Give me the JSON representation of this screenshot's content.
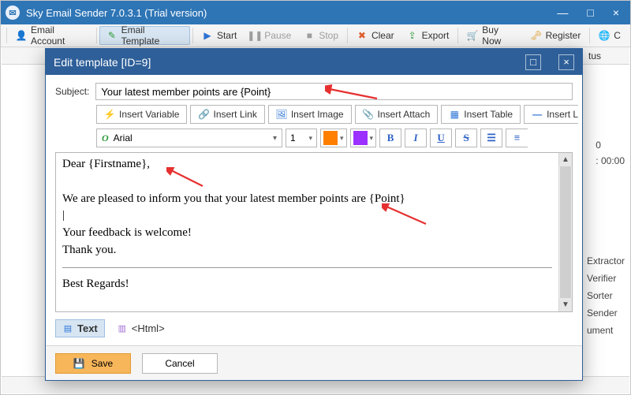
{
  "window": {
    "title": "Sky Email Sender 7.0.3.1 (Trial version)"
  },
  "toolbar": {
    "email_account": "Email Account",
    "email_template": "Email Template",
    "start": "Start",
    "pause": "Pause",
    "stop": "Stop",
    "clear": "Clear",
    "export": "Export",
    "buy_now": "Buy Now",
    "register": "Register",
    "check_update_trunc": "C"
  },
  "bg": {
    "col_status_trunc": "tus",
    "info_zero": "0",
    "info_time": ": 00:00",
    "side": {
      "extractor": "Extractor",
      "verifier": "Verifier",
      "sorter": "Sorter",
      "sender": "Sender",
      "ument": "ument"
    }
  },
  "dialog": {
    "title": "Edit template [ID=9]",
    "subject_label": "Subject:",
    "subject_value": "Your latest member points are {Point}",
    "insert_variable": "Insert Variable",
    "insert_link": "Insert Link",
    "insert_image": "Insert Image",
    "insert_attach": "Insert Attach",
    "insert_table": "Insert Table",
    "insert_l_trunc": "Insert L",
    "font_name": "Arial",
    "font_size": "1",
    "body_line1": "Dear {Firstname},",
    "body_line2": "We are pleased to inform you that your latest member points are {Point}",
    "body_line3": "Your feedback is welcome!",
    "body_line4": "Thank you.",
    "body_line5": "Best Regards!",
    "tab_text": "Text",
    "tab_html": "<Html>",
    "save": "Save",
    "cancel": "Cancel"
  }
}
